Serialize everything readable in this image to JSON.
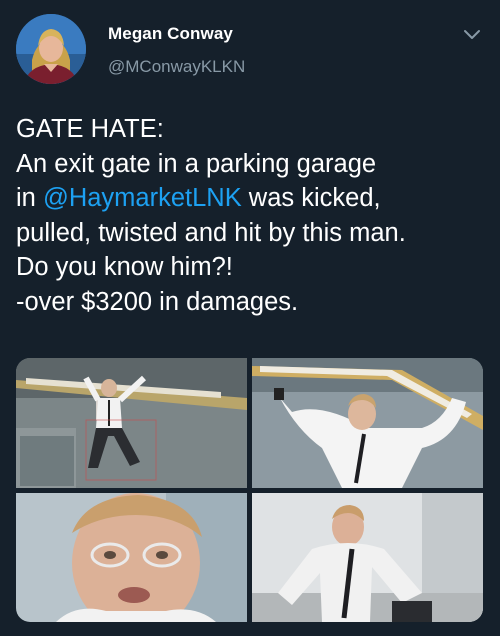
{
  "author": {
    "name": "Megan Conway",
    "handle": "@MConwayKLKN",
    "avatar_icon": "profile-photo"
  },
  "menu_icon": "chevron-down-icon",
  "tweet": {
    "line1": "GATE HATE:",
    "line2": "An exit gate in a parking garage",
    "line3_prefix": "in ",
    "mention": "@HaymarketLNK",
    "line3_suffix": " was kicked,",
    "line4": "pulled, twisted and hit by this man.",
    "line5": "Do you know him?!",
    "line6": "-over $3200 in damages."
  },
  "colors": {
    "background": "#15202b",
    "text": "#ffffff",
    "secondary_text": "#8899a6",
    "link": "#1da1f2"
  },
  "media": {
    "photos": [
      {
        "id": "photo-1",
        "description_icon": "surveillance-still-full-body"
      },
      {
        "id": "photo-2",
        "description_icon": "surveillance-still-arm-raised"
      },
      {
        "id": "photo-3",
        "description_icon": "surveillance-still-face-closeup"
      },
      {
        "id": "photo-4",
        "description_icon": "surveillance-still-crouching"
      }
    ]
  }
}
